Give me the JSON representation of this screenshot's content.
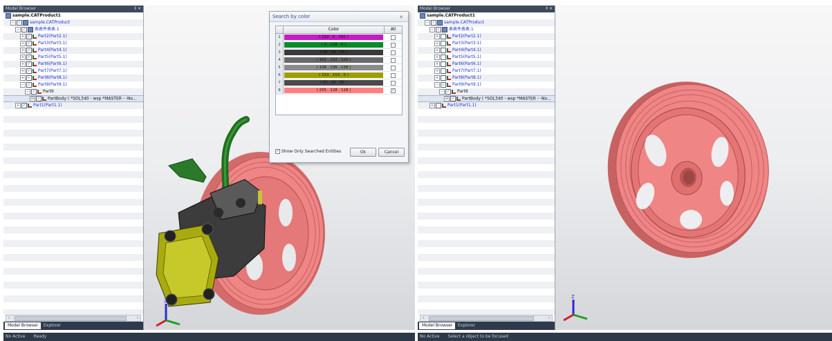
{
  "left": {
    "panel_title": "Model Browser",
    "pin_glyphs": "‡ ✕",
    "tree": [
      {
        "label": "sample.CATProduct1",
        "level": 0,
        "kind": "root",
        "checked": null,
        "expander": ""
      },
      {
        "label": "sample.CATProduct",
        "level": 1,
        "kind": "product",
        "checked": true,
        "expander": "−"
      },
      {
        "label": "表表件表表.1",
        "level": 2,
        "kind": "product",
        "checked": true,
        "expander": "−"
      },
      {
        "label": "Part2(Part2.1)",
        "level": 3,
        "kind": "part",
        "checked": true,
        "expander": "+"
      },
      {
        "label": "Part3(Part3.1)",
        "level": 3,
        "kind": "part",
        "checked": true,
        "expander": "+"
      },
      {
        "label": "Part4(Part4.1)",
        "level": 3,
        "kind": "part",
        "checked": true,
        "expander": "+"
      },
      {
        "label": "Part5(Part5.1)",
        "level": 3,
        "kind": "part",
        "checked": true,
        "expander": "+"
      },
      {
        "label": "Part6(Part6.1)",
        "level": 3,
        "kind": "part",
        "checked": true,
        "expander": "+"
      },
      {
        "label": "Part7(Part7.1)",
        "level": 3,
        "kind": "part",
        "checked": true,
        "expander": "+"
      },
      {
        "label": "Part8(Part8.1)",
        "level": 3,
        "kind": "part",
        "checked": true,
        "expander": "+"
      },
      {
        "label": "Part9(Part9.1)",
        "level": 3,
        "kind": "part",
        "checked": true,
        "expander": "−"
      },
      {
        "label": "Part9",
        "level": 4,
        "kind": "part",
        "checked": true,
        "expander": "−",
        "dark": true
      },
      {
        "label": "PartBody ( *SOL340 - wsp *MASTER -  -No...",
        "level": 5,
        "kind": "part",
        "checked": true,
        "expander": "⊟",
        "dark": true,
        "selected": true
      },
      {
        "label": "Part1(Part1.1)",
        "level": 2,
        "kind": "part",
        "checked": true,
        "expander": "+"
      }
    ],
    "tabs": [
      "Model Browser",
      "Explorer"
    ],
    "status": [
      "No Active",
      "Ready"
    ],
    "dialog": {
      "title": "Search by color",
      "close": "✕",
      "col_color": "Color",
      "col_all": "All",
      "rows": [
        {
          "n": "1",
          "color": "#c21ec2",
          "text": "( 192 , 0 , 192 )",
          "checked": false
        },
        {
          "n": "2",
          "color": "#0a8a2a",
          "text": "( 0 , 128 , 0 )",
          "checked": false
        },
        {
          "n": "3",
          "color": "#3a3a3a",
          "text": "( 64 , 64 , 64 )",
          "checked": false
        },
        {
          "n": "4",
          "color": "#686868",
          "text": "( 102 , 102 , 102 )",
          "checked": false
        },
        {
          "n": "5",
          "color": "#8a8a8a",
          "text": "( 136 , 136 , 136 )",
          "checked": false
        },
        {
          "n": "6",
          "color": "#9e9e00",
          "text": "( 153 , 153 , 0 )",
          "checked": false
        },
        {
          "n": "7",
          "color": "#4a4a4a",
          "text": "( 85 , 85 , 85 )",
          "checked": false
        },
        {
          "n": "8",
          "color": "#ff8080",
          "text": "( 255 , 128 , 128 )",
          "checked": true
        }
      ],
      "show_only": "Show Only Searched Entities",
      "ok": "Ok",
      "cancel": "Cancel"
    }
  },
  "right": {
    "panel_title": "Model Browser",
    "pin_glyphs": "‡ ✕",
    "tree": [
      {
        "label": "sample.CATProduct1",
        "level": 0,
        "kind": "root",
        "checked": null,
        "expander": ""
      },
      {
        "label": "sample.CATProduct",
        "level": 1,
        "kind": "product",
        "checked": true,
        "expander": "−"
      },
      {
        "label": "表表件表表.1",
        "level": 2,
        "kind": "product",
        "checked": true,
        "expander": "−"
      },
      {
        "label": "Part2(Part2.1)",
        "level": 3,
        "kind": "part",
        "checked": false,
        "expander": "+"
      },
      {
        "label": "Part3(Part3.1)",
        "level": 3,
        "kind": "part",
        "checked": false,
        "expander": "+"
      },
      {
        "label": "Part4(Part4.1)",
        "level": 3,
        "kind": "part",
        "checked": false,
        "expander": "+"
      },
      {
        "label": "Part5(Part5.1)",
        "level": 3,
        "kind": "part",
        "checked": false,
        "expander": "+"
      },
      {
        "label": "Part6(Part6.1)",
        "level": 3,
        "kind": "part",
        "checked": false,
        "expander": "+"
      },
      {
        "label": "Part7(Part7.1)",
        "level": 3,
        "kind": "part",
        "checked": false,
        "expander": "+"
      },
      {
        "label": "Part8(Part8.1)",
        "level": 3,
        "kind": "part",
        "checked": false,
        "expander": "+"
      },
      {
        "label": "Part9(Part9.1)",
        "level": 3,
        "kind": "part",
        "checked": true,
        "expander": "−"
      },
      {
        "label": "Part9",
        "level": 4,
        "kind": "part",
        "checked": true,
        "expander": "−",
        "dark": true
      },
      {
        "label": "PartBody ( *SOL340 - wsp *MASTER -  -No...",
        "level": 5,
        "kind": "part",
        "checked": true,
        "expander": "⊟",
        "dark": true,
        "selected": true
      },
      {
        "label": "Part1(Part1.1)",
        "level": 2,
        "kind": "part",
        "checked": false,
        "expander": "+"
      }
    ],
    "tabs": [
      "Model Browser",
      "Explorer"
    ],
    "status": [
      "No Active",
      "Select a object to be focused"
    ]
  },
  "colors": {
    "pulley": "#ef8585",
    "hose": "#1f6d1f",
    "pump_body": "#a8aa10",
    "dark_metal": "#3c3c3c",
    "tree_link": "#2233cc"
  }
}
